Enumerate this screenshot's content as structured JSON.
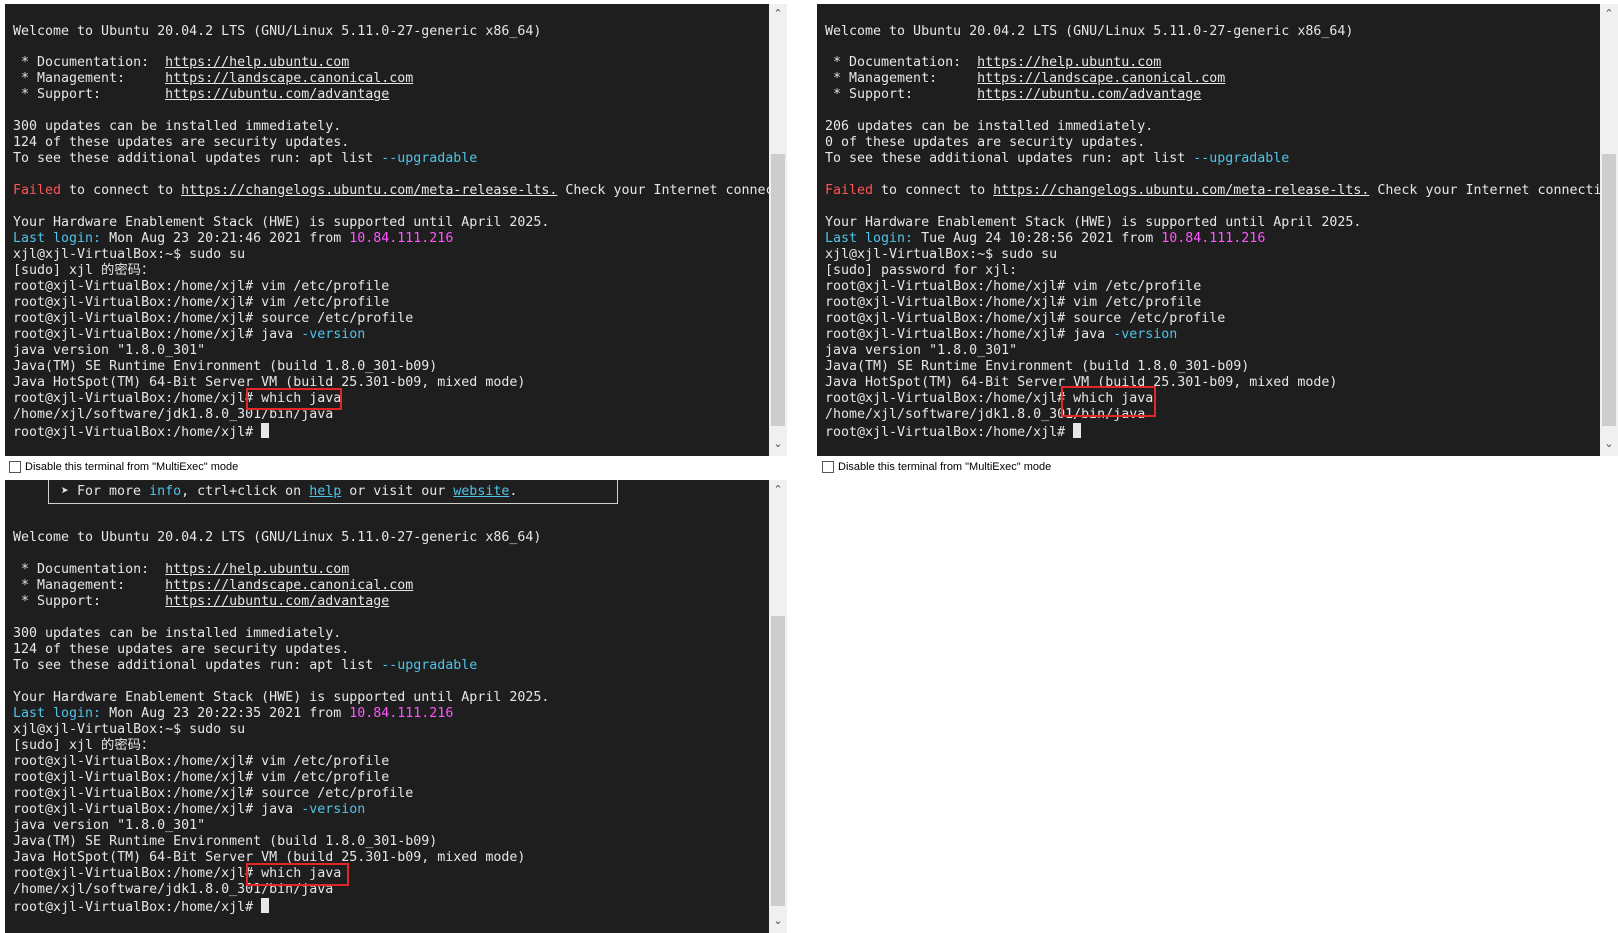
{
  "checkbox_label": "Disable this terminal from \"MultiExec\" mode",
  "banner": {
    "prefix": "➤ For more ",
    "info": "info",
    "mid1": ", ctrl+click on ",
    "help": "help",
    "mid2": " or visit our ",
    "website": "website",
    "end": "."
  },
  "motd": {
    "welcome": "Welcome to Ubuntu 20.04.2 LTS (GNU/Linux 5.11.0-27-generic x86_64)",
    "doc_label": " * Documentation:  ",
    "doc_url": "https://help.ubuntu.com",
    "mgmt_label": " * Management:     ",
    "mgmt_url": "https://landscape.canonical.com",
    "support_label": " * Support:        ",
    "support_url": "https://ubuntu.com/advantage",
    "upgrade_prefix": "To see these additional updates run: apt list ",
    "upgrade_flag": "--upgradable",
    "failed_word": "Failed",
    "failed_mid": " to connect to ",
    "failed_url": "https://changelogs.ubuntu.com/meta-release-lts.",
    "failed_end": " Check your Internet connecti",
    "hwe": "Your Hardware Enablement Stack (HWE) is supported until April 2025.",
    "last_login_label": "Last login:",
    "from_word": " from ",
    "ip": "10.84.111.216"
  },
  "commands": {
    "sudo_su": "xjl@xjl-VirtualBox:~$ sudo su",
    "vim1": "root@xjl-VirtualBox:/home/xjl# vim /etc/profile",
    "vim2": "root@xjl-VirtualBox:/home/xjl# vim /etc/profile",
    "source": "root@xjl-VirtualBox:/home/xjl# source /etc/profile",
    "java_prefix": "root@xjl-VirtualBox:/home/xjl# java ",
    "java_flag": "-version",
    "java_version": "java version \"1.8.0_301\"",
    "jre": "Java(TM) SE Runtime Environment (build 1.8.0_301-b09)",
    "hotspot": "Java HotSpot(TM) 64-Bit Server VM (build 25.301-b09, mixed mode)",
    "which_prefix": "root@xjl-VirtualBox:/home/xjl# ",
    "which_cmd": "which java",
    "java_path": "/home/xjl/software/jdk1.8.0_301/bin/java",
    "prompt": "root@xjl-VirtualBox:/home/xjl# "
  },
  "panes": [
    {
      "updates": "300 updates can be installed immediately.",
      "security": "124 of these updates are security updates.",
      "last_login_time": " Mon Aug 23 20:21:46 2021",
      "sudo_prompt": "[sudo] xjl 的密码："
    },
    {
      "updates": "206 updates can be installed immediately.",
      "security": "0 of these updates are security updates.",
      "last_login_time": " Tue Aug 24 10:28:56 2021",
      "sudo_prompt": "[sudo] password for xjl:"
    },
    {
      "updates": "300 updates can be installed immediately.",
      "security": "124 of these updates are security updates.",
      "last_login_time": " Mon Aug 23 20:22:35 2021",
      "sudo_prompt": "[sudo] xjl 的密码："
    }
  ]
}
